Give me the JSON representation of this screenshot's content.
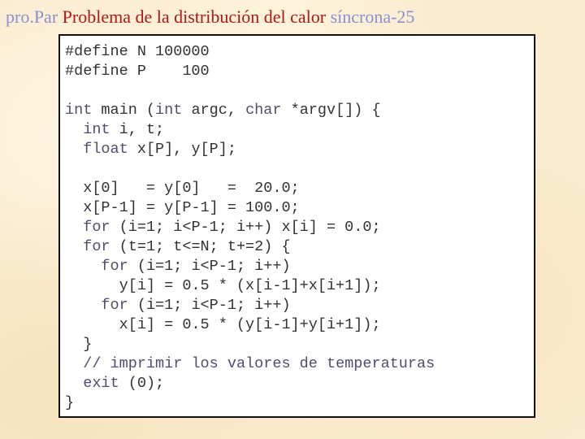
{
  "slide": {
    "title_prefix": "pro.Par",
    "title_main": "Problema de la distribución del calor",
    "title_suffix": "síncrona-25"
  },
  "code": {
    "language": "C",
    "lines": [
      [
        {
          "t": "#define N 100000"
        }
      ],
      [
        {
          "t": "#define P    100"
        }
      ],
      [
        {
          "t": ""
        }
      ],
      [
        {
          "t": "int",
          "k": true
        },
        {
          "t": " main ("
        },
        {
          "t": "int",
          "k": true
        },
        {
          "t": " argc, "
        },
        {
          "t": "char",
          "k": true
        },
        {
          "t": " *argv[]) {"
        }
      ],
      [
        {
          "t": "  "
        },
        {
          "t": "int",
          "k": true
        },
        {
          "t": " i, t;"
        }
      ],
      [
        {
          "t": "  "
        },
        {
          "t": "float",
          "k": true
        },
        {
          "t": " x[P], y[P];"
        }
      ],
      [
        {
          "t": ""
        }
      ],
      [
        {
          "t": "  x[0]   = y[0]   =  20.0;"
        }
      ],
      [
        {
          "t": "  x[P-1] = y[P-1] = 100.0;"
        }
      ],
      [
        {
          "t": "  "
        },
        {
          "t": "for",
          "k": true
        },
        {
          "t": " (i=1; i<P-1; i++) x[i] = 0.0;"
        }
      ],
      [
        {
          "t": "  "
        },
        {
          "t": "for",
          "k": true
        },
        {
          "t": " (t=1; t<=N; t+=2) {"
        }
      ],
      [
        {
          "t": "    "
        },
        {
          "t": "for",
          "k": true
        },
        {
          "t": " (i=1; i<P-1; i++)"
        }
      ],
      [
        {
          "t": "      y[i] = 0.5 * (x[i-1]+x[i+1]);"
        }
      ],
      [
        {
          "t": "    "
        },
        {
          "t": "for",
          "k": true
        },
        {
          "t": " (i=1; i<P-1; i++)"
        }
      ],
      [
        {
          "t": "      x[i] = 0.5 * (y[i-1]+y[i+1]);"
        }
      ],
      [
        {
          "t": "  }"
        }
      ],
      [
        {
          "t": "  "
        },
        {
          "t": "// imprimir los valores de temperaturas",
          "k": true
        }
      ],
      [
        {
          "t": "  "
        },
        {
          "t": "exit",
          "k": true
        },
        {
          "t": " (0);"
        }
      ],
      [
        {
          "t": "}"
        }
      ]
    ]
  }
}
